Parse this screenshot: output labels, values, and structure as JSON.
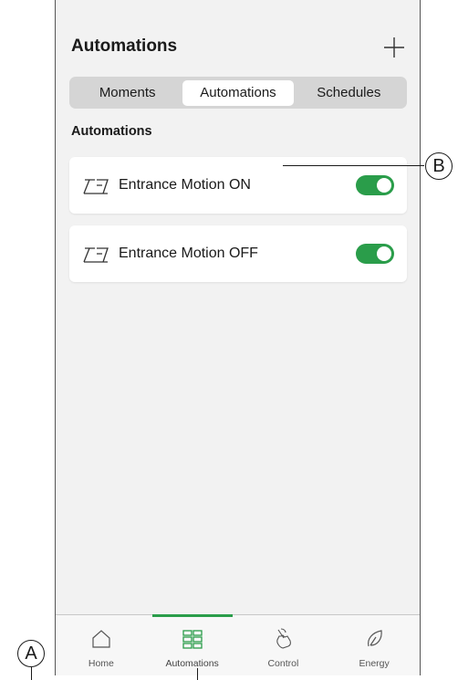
{
  "header": {
    "title": "Automations",
    "add_icon": "plus-icon"
  },
  "segments": [
    {
      "label": "Moments",
      "active": false
    },
    {
      "label": "Automations",
      "active": true
    },
    {
      "label": "Schedules",
      "active": false
    }
  ],
  "section": {
    "label": "Automations"
  },
  "automations": [
    {
      "label": "Entrance Motion ON",
      "icon": "motion-sensor-icon",
      "enabled": true
    },
    {
      "label": "Entrance Motion OFF",
      "icon": "motion-sensor-icon",
      "enabled": true
    }
  ],
  "tabbar": [
    {
      "label": "Home",
      "icon": "home-icon",
      "active": false
    },
    {
      "label": "Automations",
      "icon": "grid-icon",
      "active": true
    },
    {
      "label": "Control",
      "icon": "hand-touch-icon",
      "active": false
    },
    {
      "label": "Energy",
      "icon": "leaf-icon",
      "active": false
    }
  ],
  "callouts": {
    "a": "A",
    "b": "B"
  },
  "colors": {
    "accent": "#2a9d4a",
    "background": "#f2f2f2",
    "segment_bg": "#d5d5d5"
  }
}
